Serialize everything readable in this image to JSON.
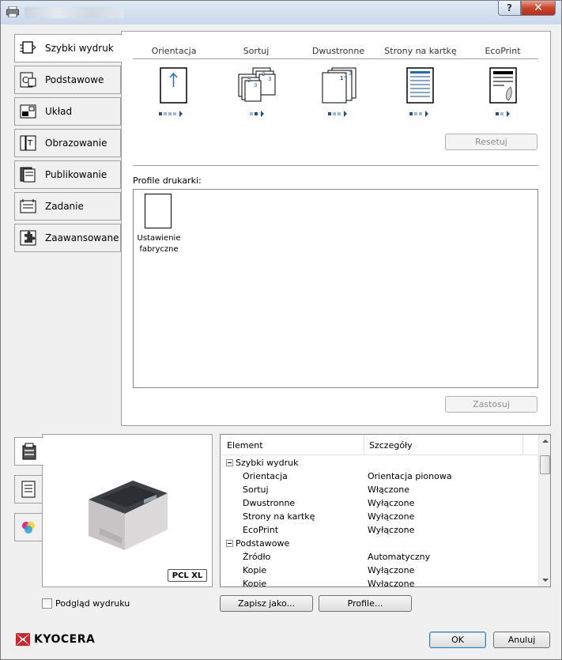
{
  "window": {
    "help_label": "?",
    "close_label": "✕"
  },
  "tabs": [
    {
      "label": "Szybki wydruk"
    },
    {
      "label": "Podstawowe"
    },
    {
      "label": "Układ"
    },
    {
      "label": "Obrazowanie"
    },
    {
      "label": "Publikowanie"
    },
    {
      "label": "Zadanie"
    },
    {
      "label": "Zaawansowane"
    }
  ],
  "quick_print": {
    "columns": [
      {
        "label": "Orientacja",
        "steps": 4,
        "selected": 1
      },
      {
        "label": "Sortuj",
        "steps": 2,
        "selected": 2
      },
      {
        "label": "Dwustronne",
        "steps": 3,
        "selected": 1
      },
      {
        "label": "Strony na kartkę",
        "steps": 3,
        "selected": 1
      },
      {
        "label": "EcoPrint",
        "steps": 2,
        "selected": 1
      }
    ],
    "reset_label": "Resetuj"
  },
  "profiles": {
    "label": "Profile drukarki:",
    "items": [
      {
        "label_line1": "Ustawienie",
        "label_line2": "fabryczne"
      }
    ],
    "apply_label": "Zastosuj"
  },
  "preview": {
    "badge": "PCL XL",
    "checkbox_label": "Podgląd wydruku",
    "checkbox_checked": false
  },
  "details": {
    "headers": [
      "Element",
      "Szczegóły"
    ],
    "rows": [
      {
        "level": 0,
        "name": "Szybki wydruk",
        "value": ""
      },
      {
        "level": 1,
        "name": "Orientacja",
        "value": "Orientacja pionowa"
      },
      {
        "level": 1,
        "name": "Sortuj",
        "value": "Włączone"
      },
      {
        "level": 1,
        "name": "Dwustronne",
        "value": "Wyłączone"
      },
      {
        "level": 1,
        "name": "Strony na kartkę",
        "value": "Wyłączone"
      },
      {
        "level": 1,
        "name": "EcoPrint",
        "value": "Wyłączone"
      },
      {
        "level": 0,
        "name": "Podstawowe",
        "value": ""
      },
      {
        "level": 1,
        "name": "Źródło",
        "value": "Automatyczny"
      },
      {
        "level": 1,
        "name": "Kopie",
        "value": "Wyłączone"
      },
      {
        "level": 1,
        "name": "Kopie",
        "value": "Wyłączone"
      }
    ]
  },
  "buttons": {
    "save_as": "Zapisz jako...",
    "profiles": "Profile...",
    "ok": "OK",
    "cancel": "Anuluj"
  },
  "brand": {
    "name": "KYOCERA",
    "color": "#d2232a"
  }
}
